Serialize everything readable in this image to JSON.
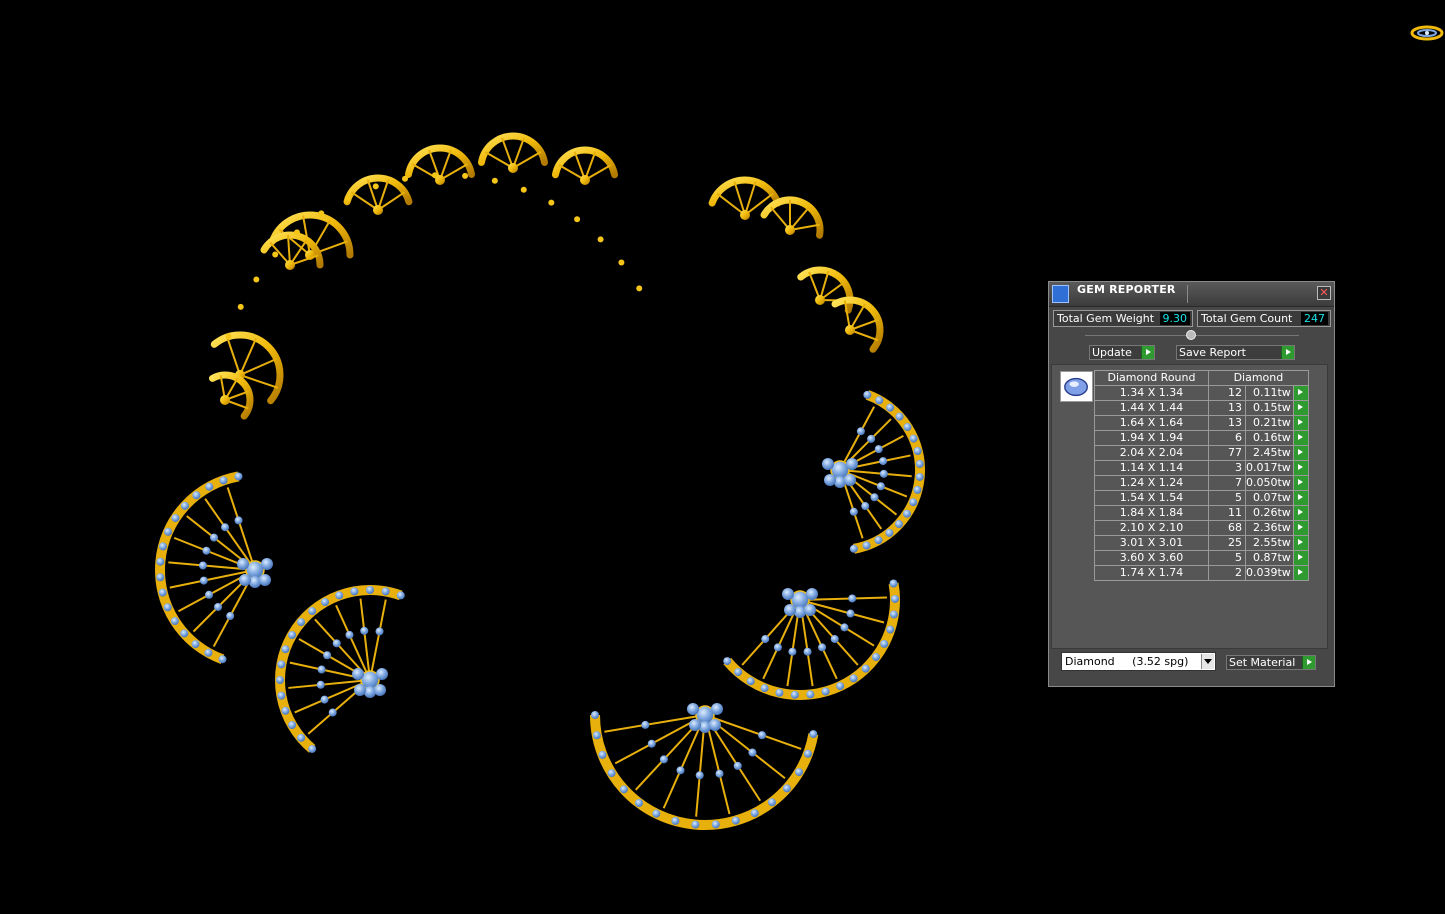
{
  "viewport": {
    "name": "3D necklace model viewport",
    "background": "#000000"
  },
  "gem_reporter": {
    "title": "GEM REPORTER",
    "close_symbol": "✕",
    "total_gem_weight_label": "Total Gem Weight",
    "total_gem_weight_value": "9.30",
    "total_gem_count_label": "Total Gem Count",
    "total_gem_count_value": "247",
    "update_label": "Update",
    "save_report_label": "Save Report",
    "table": {
      "header_shape": "Diamond Round",
      "header_material": "Diamond",
      "rows": [
        {
          "size": "1.34 X 1.34",
          "count": "12",
          "weight": "0.11tw"
        },
        {
          "size": "1.44 X 1.44",
          "count": "13",
          "weight": "0.15tw"
        },
        {
          "size": "1.64 X 1.64",
          "count": "13",
          "weight": "0.21tw"
        },
        {
          "size": "1.94 X 1.94",
          "count": "6",
          "weight": "0.16tw"
        },
        {
          "size": "2.04 X 2.04",
          "count": "77",
          "weight": "2.45tw"
        },
        {
          "size": "1.14 X 1.14",
          "count": "3",
          "weight": "0.017tw"
        },
        {
          "size": "1.24 X 1.24",
          "count": "7",
          "weight": "0.050tw"
        },
        {
          "size": "1.54 X 1.54",
          "count": "5",
          "weight": "0.07tw"
        },
        {
          "size": "1.84 X 1.84",
          "count": "11",
          "weight": "0.26tw"
        },
        {
          "size": "2.10 X 2.10",
          "count": "68",
          "weight": "2.36tw"
        },
        {
          "size": "3.01 X 3.01",
          "count": "25",
          "weight": "2.55tw"
        },
        {
          "size": "3.60 X 3.60",
          "count": "5",
          "weight": "0.87tw"
        },
        {
          "size": "1.74 X 1.74",
          "count": "2",
          "weight": "0.039tw"
        }
      ]
    },
    "material_select_value": "Diamond     (3.52 spg)",
    "set_material_label": "Set Material",
    "colors": {
      "value_text": "#19e0e6",
      "go_button": "#2f9a2f",
      "panel": "#474747"
    }
  },
  "icons": {
    "title_icon": "gem-reporter-app-icon",
    "gem_preview": "round-diamond-icon",
    "nav": "view-navigator-icon"
  }
}
